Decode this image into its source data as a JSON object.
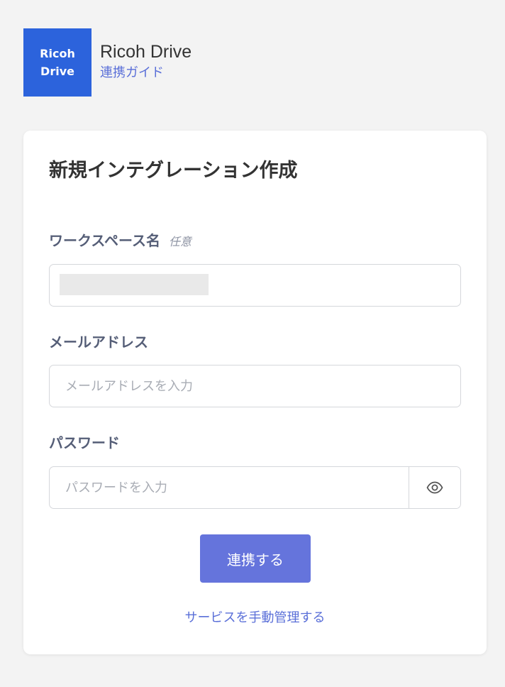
{
  "header": {
    "logo_line1": "Ricoh",
    "logo_line2": "Drive",
    "app_name": "Ricoh Drive",
    "guide_link": "連携ガイド"
  },
  "form": {
    "title": "新規インテグレーション作成",
    "workspace": {
      "label": "ワークスペース名",
      "optional_tag": "任意",
      "value": "",
      "value_redacted": true
    },
    "email": {
      "label": "メールアドレス",
      "placeholder": "メールアドレスを入力",
      "value": ""
    },
    "password": {
      "label": "パスワード",
      "placeholder": "パスワードを入力",
      "value": "",
      "toggle_icon": "eye-icon"
    },
    "submit_label": "連携する",
    "manual_link": "サービスを手動管理する"
  },
  "colors": {
    "background": "#f3f3f3",
    "logo_bg": "#2c63dc",
    "accent": "#6574dc",
    "link": "#5a6fd8",
    "label": "#555e77"
  }
}
